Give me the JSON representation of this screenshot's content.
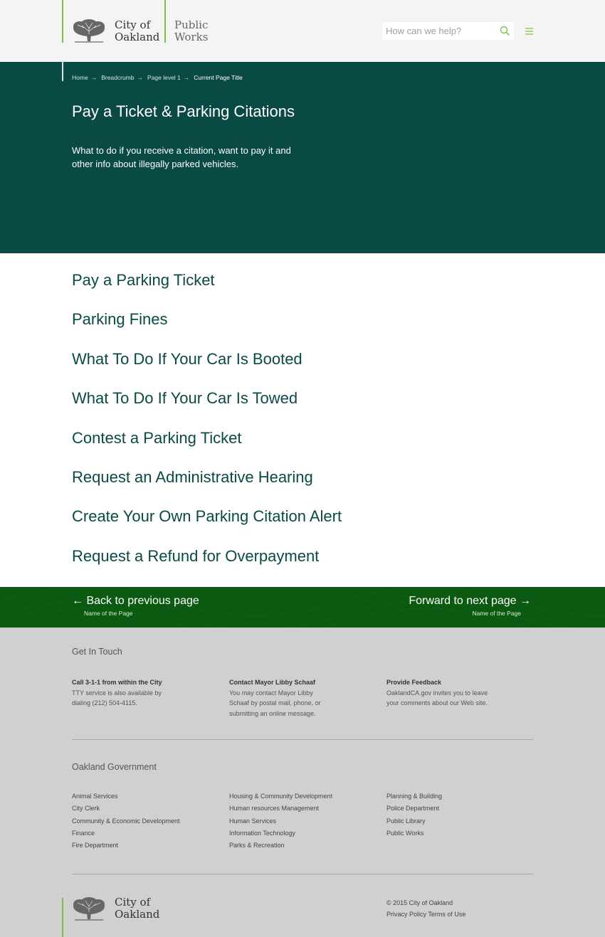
{
  "header": {
    "city_line1": "City of",
    "city_line2": "Oakland",
    "dept_line1": "Public",
    "dept_line2": "Works",
    "search_placeholder": "How can we help?",
    "accent_color": "#7ac143"
  },
  "hero": {
    "breadcrumb": {
      "items": [
        "Home",
        "Breadcrumb",
        "Page level 1"
      ],
      "separator": "→",
      "current": "Current Page Title"
    },
    "title": "Pay a Ticket & Parking Citations",
    "description": "What to do if you receive a citation, want to pay it and other info about illegally parked vehicles.",
    "background_color": "#0a4a44"
  },
  "links": [
    "Pay a Parking Ticket",
    "Parking Fines",
    "What To Do If Your Car Is Booted",
    "What To Do If Your Car Is Towed",
    "Contest a Parking Ticket",
    "Request an Administrative Hearing",
    "Create Your Own Parking Citation Alert",
    "Request a Refund for Overpayment"
  ],
  "pager": {
    "prev_label": "Back to previous page",
    "prev_sub": "Name of the Page",
    "next_label": "Forward to next page",
    "next_sub": "Name of the Page",
    "background_color": "#0c5a12"
  },
  "footer": {
    "contact_heading": "Get In Touch",
    "contact": [
      {
        "title": "Call 3-1-1 from within the City",
        "body": "TTY service is also available by dialing (212) 504-4115."
      },
      {
        "title": "Contact Mayor Libby Schaaf",
        "body": "You may contact Mayor Libby Schaaf by postal mail, phone, or submitting an online message."
      },
      {
        "title": "Provide Feedback",
        "body": "OaklandCA.gov invites you to leave your comments about our Web site."
      }
    ],
    "gov_heading": "Oakland Government",
    "gov_columns": [
      [
        "Animal Services",
        "City Clerk",
        "Community & Economic Development",
        "Finance",
        "Fire Department"
      ],
      [
        "Housing & Community Development",
        "Human resources Management",
        "Human Services",
        "Information Technology",
        "Parks & Recreation"
      ],
      [
        "Planning & Building",
        "Police Department",
        "Public Library",
        "Public Works"
      ]
    ],
    "city_line1": "City of",
    "city_line2": "Oakland",
    "copyright": "© 2015 City of Oakland",
    "privacy": "Privacy Policy",
    "terms": "Terms of Use"
  }
}
